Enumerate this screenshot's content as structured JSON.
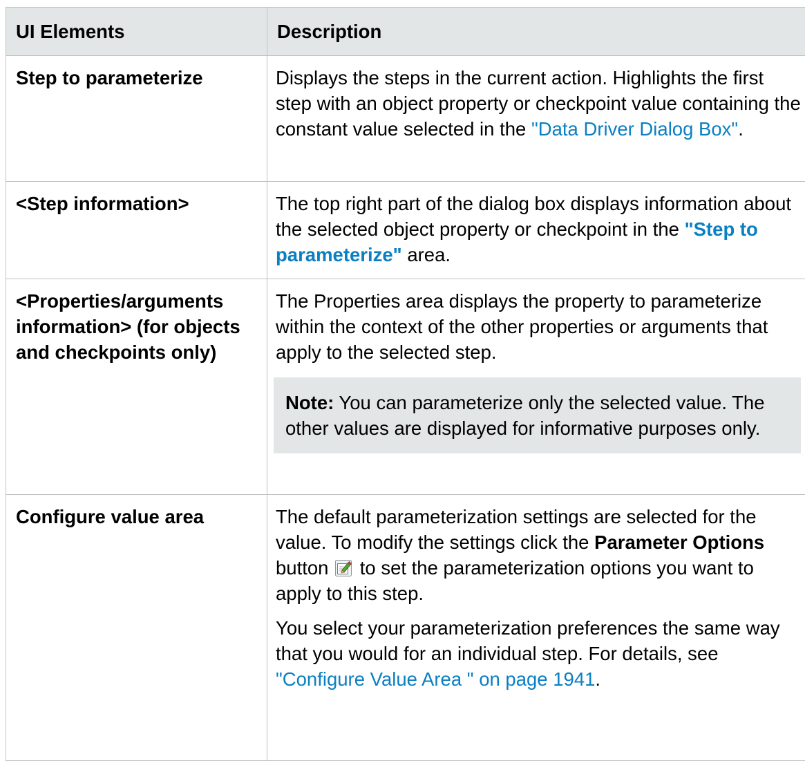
{
  "table": {
    "headers": [
      "UI Elements",
      "Description"
    ],
    "rows": [
      {
        "term": "Step to parameterize",
        "desc": {
          "t1": "Displays the steps in the current action. Highlights the first step with an object property or checkpoint value containing the constant value selected in the ",
          "link": "\"Data Driver Dialog Box\"",
          "t2": "."
        }
      },
      {
        "term": "<Step information>",
        "desc": {
          "t1": "The top right part of the dialog box displays information about the selected object property or checkpoint in the ",
          "link": "\"Step to parameterize\"",
          "t2": " area."
        }
      },
      {
        "term": "<Properties/arguments information> (for objects and checkpoints only)",
        "desc": {
          "text": "The Properties area displays the property to parameterize within the context of the other properties or arguments that apply to the selected step.",
          "note_label": "Note:",
          "note_text": " You can parameterize only the selected value. The other values are displayed for informative purposes only."
        }
      },
      {
        "term": "Configure value area",
        "desc": {
          "p1_t1": "The default parameterization settings are selected for the value. To modify the settings click the ",
          "p1_bold": "Parameter Options",
          "p1_t2": " button ",
          "p1_t3": " to set the parameterization options you want to apply to this step.",
          "p2_t1": "You select your parameterization preferences the same way that you would for an individual step. For details, see ",
          "p2_link": "\"Configure Value Area \" on page 1941",
          "p2_t2": "."
        }
      }
    ]
  },
  "icons": {
    "parameter_options": "parameter-options-icon"
  },
  "colors": {
    "header_bg": "#e3e6e7",
    "note_bg": "#e3e6e7",
    "link": "#0a7fc2",
    "border": "#bfbfbf"
  }
}
